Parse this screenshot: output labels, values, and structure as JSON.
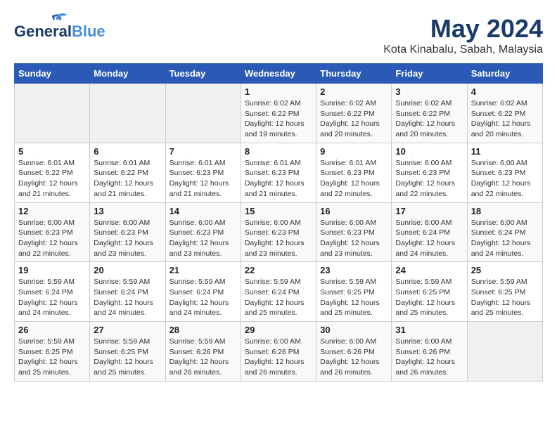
{
  "header": {
    "logo_line1": "General",
    "logo_line2": "Blue",
    "month": "May 2024",
    "location": "Kota Kinabalu, Sabah, Malaysia"
  },
  "weekdays": [
    "Sunday",
    "Monday",
    "Tuesday",
    "Wednesday",
    "Thursday",
    "Friday",
    "Saturday"
  ],
  "weeks": [
    [
      {
        "day": "",
        "detail": ""
      },
      {
        "day": "",
        "detail": ""
      },
      {
        "day": "",
        "detail": ""
      },
      {
        "day": "1",
        "detail": "Sunrise: 6:02 AM\nSunset: 6:22 PM\nDaylight: 12 hours\nand 19 minutes."
      },
      {
        "day": "2",
        "detail": "Sunrise: 6:02 AM\nSunset: 6:22 PM\nDaylight: 12 hours\nand 20 minutes."
      },
      {
        "day": "3",
        "detail": "Sunrise: 6:02 AM\nSunset: 6:22 PM\nDaylight: 12 hours\nand 20 minutes."
      },
      {
        "day": "4",
        "detail": "Sunrise: 6:02 AM\nSunset: 6:22 PM\nDaylight: 12 hours\nand 20 minutes."
      }
    ],
    [
      {
        "day": "5",
        "detail": "Sunrise: 6:01 AM\nSunset: 6:22 PM\nDaylight: 12 hours\nand 21 minutes."
      },
      {
        "day": "6",
        "detail": "Sunrise: 6:01 AM\nSunset: 6:22 PM\nDaylight: 12 hours\nand 21 minutes."
      },
      {
        "day": "7",
        "detail": "Sunrise: 6:01 AM\nSunset: 6:23 PM\nDaylight: 12 hours\nand 21 minutes."
      },
      {
        "day": "8",
        "detail": "Sunrise: 6:01 AM\nSunset: 6:23 PM\nDaylight: 12 hours\nand 21 minutes."
      },
      {
        "day": "9",
        "detail": "Sunrise: 6:01 AM\nSunset: 6:23 PM\nDaylight: 12 hours\nand 22 minutes."
      },
      {
        "day": "10",
        "detail": "Sunrise: 6:00 AM\nSunset: 6:23 PM\nDaylight: 12 hours\nand 22 minutes."
      },
      {
        "day": "11",
        "detail": "Sunrise: 6:00 AM\nSunset: 6:23 PM\nDaylight: 12 hours\nand 22 minutes."
      }
    ],
    [
      {
        "day": "12",
        "detail": "Sunrise: 6:00 AM\nSunset: 6:23 PM\nDaylight: 12 hours\nand 22 minutes."
      },
      {
        "day": "13",
        "detail": "Sunrise: 6:00 AM\nSunset: 6:23 PM\nDaylight: 12 hours\nand 23 minutes."
      },
      {
        "day": "14",
        "detail": "Sunrise: 6:00 AM\nSunset: 6:23 PM\nDaylight: 12 hours\nand 23 minutes."
      },
      {
        "day": "15",
        "detail": "Sunrise: 6:00 AM\nSunset: 6:23 PM\nDaylight: 12 hours\nand 23 minutes."
      },
      {
        "day": "16",
        "detail": "Sunrise: 6:00 AM\nSunset: 6:23 PM\nDaylight: 12 hours\nand 23 minutes."
      },
      {
        "day": "17",
        "detail": "Sunrise: 6:00 AM\nSunset: 6:24 PM\nDaylight: 12 hours\nand 24 minutes."
      },
      {
        "day": "18",
        "detail": "Sunrise: 6:00 AM\nSunset: 6:24 PM\nDaylight: 12 hours\nand 24 minutes."
      }
    ],
    [
      {
        "day": "19",
        "detail": "Sunrise: 5:59 AM\nSunset: 6:24 PM\nDaylight: 12 hours\nand 24 minutes."
      },
      {
        "day": "20",
        "detail": "Sunrise: 5:59 AM\nSunset: 6:24 PM\nDaylight: 12 hours\nand 24 minutes."
      },
      {
        "day": "21",
        "detail": "Sunrise: 5:59 AM\nSunset: 6:24 PM\nDaylight: 12 hours\nand 24 minutes."
      },
      {
        "day": "22",
        "detail": "Sunrise: 5:59 AM\nSunset: 6:24 PM\nDaylight: 12 hours\nand 25 minutes."
      },
      {
        "day": "23",
        "detail": "Sunrise: 5:59 AM\nSunset: 6:25 PM\nDaylight: 12 hours\nand 25 minutes."
      },
      {
        "day": "24",
        "detail": "Sunrise: 5:59 AM\nSunset: 6:25 PM\nDaylight: 12 hours\nand 25 minutes."
      },
      {
        "day": "25",
        "detail": "Sunrise: 5:59 AM\nSunset: 6:25 PM\nDaylight: 12 hours\nand 25 minutes."
      }
    ],
    [
      {
        "day": "26",
        "detail": "Sunrise: 5:59 AM\nSunset: 6:25 PM\nDaylight: 12 hours\nand 25 minutes."
      },
      {
        "day": "27",
        "detail": "Sunrise: 5:59 AM\nSunset: 6:25 PM\nDaylight: 12 hours\nand 25 minutes."
      },
      {
        "day": "28",
        "detail": "Sunrise: 5:59 AM\nSunset: 6:26 PM\nDaylight: 12 hours\nand 26 minutes."
      },
      {
        "day": "29",
        "detail": "Sunrise: 6:00 AM\nSunset: 6:26 PM\nDaylight: 12 hours\nand 26 minutes."
      },
      {
        "day": "30",
        "detail": "Sunrise: 6:00 AM\nSunset: 6:26 PM\nDaylight: 12 hours\nand 26 minutes."
      },
      {
        "day": "31",
        "detail": "Sunrise: 6:00 AM\nSunset: 6:26 PM\nDaylight: 12 hours\nand 26 minutes."
      },
      {
        "day": "",
        "detail": ""
      }
    ]
  ]
}
